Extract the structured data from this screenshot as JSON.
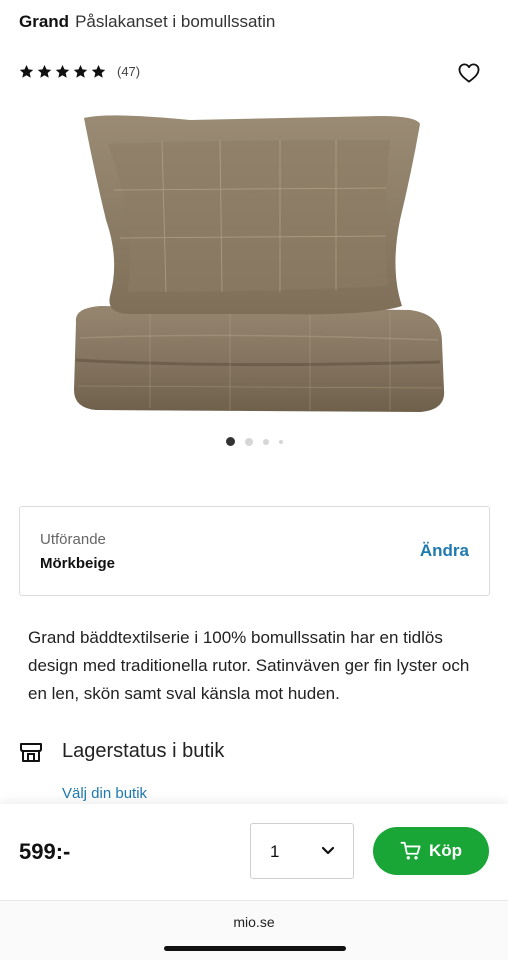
{
  "product": {
    "brand": "Grand",
    "name": "Påslakanset i bomullssatin",
    "rating_count": "(47)",
    "rating_stars": 5
  },
  "gallery": {
    "image_count": 4,
    "active_index": 0
  },
  "variant": {
    "label": "Utförande",
    "value": "Mörkbeige",
    "change_label": "Ändra"
  },
  "description": "Grand bäddtextilserie i 100% bomullssatin har en tidlös design med traditionella rutor. Satinväven ger fin lyster och en len, skön samt sval känsla mot huden.",
  "stock": {
    "title": "Lagerstatus i butik",
    "link": "Välj din butik"
  },
  "purchase": {
    "price": "599:-",
    "quantity": "1",
    "buy_label": "Köp"
  },
  "browser": {
    "url": "mio.se"
  },
  "colors": {
    "accent_green": "#1aa637",
    "link_blue": "#1f7ab0",
    "fabric_brown": "#8b7a64"
  },
  "icons": [
    "star-icon",
    "heart-icon",
    "store-icon",
    "chevron-down-icon",
    "cart-icon"
  ]
}
